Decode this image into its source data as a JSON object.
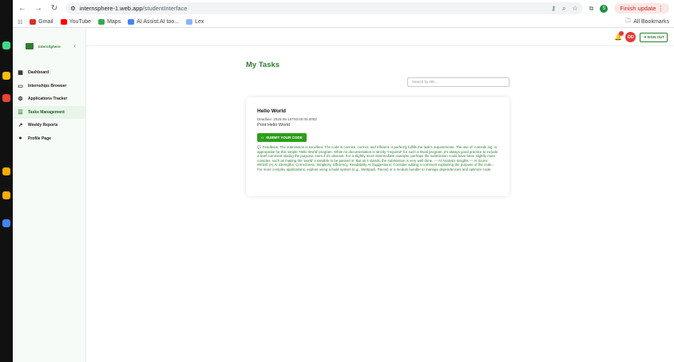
{
  "browser": {
    "url_host": "internsphere-1.web.app",
    "url_path": "/studentInterface",
    "finish_update": "Finish update",
    "profile_initial": "S",
    "bookmarks": [
      {
        "label": "Gmail",
        "color": "#d93025"
      },
      {
        "label": "YouTube",
        "color": "#ff0000"
      },
      {
        "label": "Maps",
        "color": "#34a853"
      },
      {
        "label": "AI Assist:AI too...",
        "color": "#4285f4"
      },
      {
        "label": "Lex",
        "color": "#8ab4f8"
      }
    ],
    "all_bookmarks": "All Bookmarks"
  },
  "sidebar": {
    "logo_text": "InternSphere",
    "items": [
      {
        "label": "Dashboard",
        "icon": "grid-icon"
      },
      {
        "label": "Internships Browser",
        "icon": "briefcase-icon"
      },
      {
        "label": "Applications Tracker",
        "icon": "gear-icon"
      },
      {
        "label": "Tasks Management",
        "icon": "checklist-icon"
      },
      {
        "label": "Weekly Reports",
        "icon": "trend-icon"
      },
      {
        "label": "Profile Page",
        "icon": "user-icon"
      }
    ]
  },
  "topbar": {
    "avatar_initials": "OD",
    "signout_label": "SIGN OUT"
  },
  "main": {
    "title": "My Tasks",
    "search_placeholder": "Search by title..."
  },
  "task": {
    "title": "Hello World",
    "deadline": "Deadline: 2025-06-15T00:00:00.000Z",
    "description": "Print Hello World",
    "submit_label": "SUBMIT YOUR CODE",
    "feedback": "Feedback: The submission is excellent. The code is concise, correct, and efficient. It perfectly fulfills the task's requirements. The use of `console.log` is appropriate for this simple 'Hello World' program. While no documentation is strictly *required* for such a trivial program, it's always good practice to include a brief comment stating the purpose, even if it's obvious. For a slightly more intermediate example, perhaps the submission could have been slightly more complex, such as making the 'world' a variable to be passed in. But as it stands, the submission is very well done. --- AI Analysis Insights --- AI Score: 95/100 (A) AI Strengths: Correctness, Simplicity, Efficiency, Readability AI Suggestions: Consider adding a comment explaining the purpose of the code., For more complex applications, explore using a build system (e.g., Webpack, Parcel) or a module bundler to manage dependencies and optimize code."
  }
}
